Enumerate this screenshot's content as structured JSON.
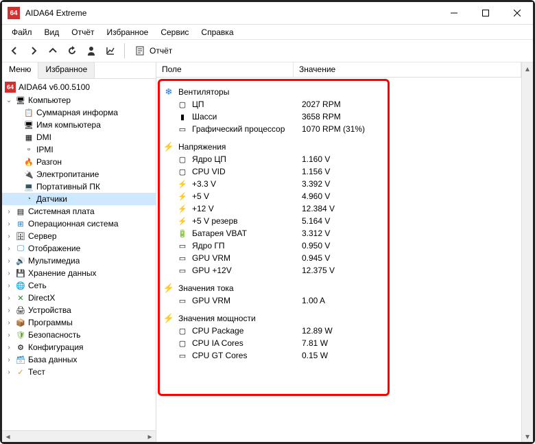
{
  "window": {
    "title": "AIDA64 Extreme"
  },
  "menubar": [
    "Файл",
    "Вид",
    "Отчёт",
    "Избранное",
    "Сервис",
    "Справка"
  ],
  "toolbar": {
    "report_label": "Отчёт"
  },
  "tabs": {
    "menu": "Меню",
    "favorites": "Избранное"
  },
  "tree": {
    "root": "AIDA64 v6.00.5100",
    "computer": {
      "label": "Компьютер",
      "children": [
        {
          "label": "Суммарная информа",
          "icon": "info"
        },
        {
          "label": "Имя компьютера",
          "icon": "pc"
        },
        {
          "label": "DMI",
          "icon": "chip"
        },
        {
          "label": "IPMI",
          "icon": "chip2"
        },
        {
          "label": "Разгон",
          "icon": "flame"
        },
        {
          "label": "Электропитание",
          "icon": "power"
        },
        {
          "label": "Портативный ПК",
          "icon": "laptop"
        },
        {
          "label": "Датчики",
          "icon": "sensor",
          "selected": true
        }
      ]
    },
    "others": [
      {
        "label": "Системная плата",
        "icon": "board"
      },
      {
        "label": "Операционная система",
        "icon": "win"
      },
      {
        "label": "Сервер",
        "icon": "server"
      },
      {
        "label": "Отображение",
        "icon": "display"
      },
      {
        "label": "Мультимедиа",
        "icon": "media"
      },
      {
        "label": "Хранение данных",
        "icon": "storage"
      },
      {
        "label": "Сеть",
        "icon": "net"
      },
      {
        "label": "DirectX",
        "icon": "dx"
      },
      {
        "label": "Устройства",
        "icon": "devices"
      },
      {
        "label": "Программы",
        "icon": "programs"
      },
      {
        "label": "Безопасность",
        "icon": "security"
      },
      {
        "label": "Конфигурация",
        "icon": "config"
      },
      {
        "label": "База данных",
        "icon": "db"
      },
      {
        "label": "Тест",
        "icon": "test"
      }
    ]
  },
  "list": {
    "col_field": "Поле",
    "col_value": "Значение",
    "sections": [
      {
        "title": "Вентиляторы",
        "icon": "fan",
        "rows": [
          {
            "field": "ЦП",
            "value": "2027 RPM",
            "icon": "cpu"
          },
          {
            "field": "Шасси",
            "value": "3658 RPM",
            "icon": "chassis"
          },
          {
            "field": "Графический процессор",
            "value": "1070 RPM  (31%)",
            "icon": "gpu"
          }
        ]
      },
      {
        "title": "Напряжения",
        "icon": "volt",
        "rows": [
          {
            "field": "Ядро ЦП",
            "value": "1.160 V",
            "icon": "cpu"
          },
          {
            "field": "CPU VID",
            "value": "1.156 V",
            "icon": "cpu"
          },
          {
            "field": "+3.3 V",
            "value": "3.392 V",
            "icon": "volt"
          },
          {
            "field": "+5 V",
            "value": "4.960 V",
            "icon": "volt"
          },
          {
            "field": "+12 V",
            "value": "12.384 V",
            "icon": "volt"
          },
          {
            "field": "+5 V резерв",
            "value": "5.164 V",
            "icon": "volt"
          },
          {
            "field": "Батарея VBAT",
            "value": "3.312 V",
            "icon": "battery"
          },
          {
            "field": "Ядро ГП",
            "value": "0.950 V",
            "icon": "gpu"
          },
          {
            "field": "GPU VRM",
            "value": "0.945 V",
            "icon": "gpu"
          },
          {
            "field": "GPU +12V",
            "value": "12.375 V",
            "icon": "gpu"
          }
        ]
      },
      {
        "title": "Значения тока",
        "icon": "volt",
        "rows": [
          {
            "field": "GPU VRM",
            "value": "1.00 A",
            "icon": "gpu"
          }
        ]
      },
      {
        "title": "Значения мощности",
        "icon": "volt",
        "rows": [
          {
            "field": "CPU Package",
            "value": "12.89 W",
            "icon": "cpu"
          },
          {
            "field": "CPU IA Cores",
            "value": "7.81 W",
            "icon": "cpu"
          },
          {
            "field": "CPU GT Cores",
            "value": "0.15 W",
            "icon": "gpu"
          }
        ]
      }
    ]
  },
  "icons": {
    "info": "📋",
    "pc": "🖥",
    "chip": "▦",
    "chip2": "▫",
    "flame": "🔥",
    "power": "🔌",
    "laptop": "💻",
    "sensor": "◔",
    "board": "▤",
    "win": "⊞",
    "server": "🗄",
    "display": "🖵",
    "media": "🔊",
    "storage": "💾",
    "net": "🌐",
    "dx": "✕",
    "devices": "🖨",
    "programs": "📦",
    "security": "🛡",
    "config": "⚙",
    "db": "🗃",
    "test": "✓",
    "fan": "❄",
    "volt": "⚡",
    "cpu": "▢",
    "chassis": "▮",
    "gpu": "▭",
    "battery": "🔋"
  },
  "icon_colors": {
    "sensor": "#2e7d32",
    "flame": "#ff6f00",
    "power": "#fbc02d",
    "fan": "#1976d2",
    "volt": "#ff6f00",
    "battery": "#2e7d32",
    "win": "#0078d4",
    "dx": "#2e7d32",
    "security": "#689f38",
    "db": "#0288d1",
    "test": "#fb8c00",
    "net": "#0288d1",
    "display": "#0288d1",
    "media": "#546e7a"
  }
}
